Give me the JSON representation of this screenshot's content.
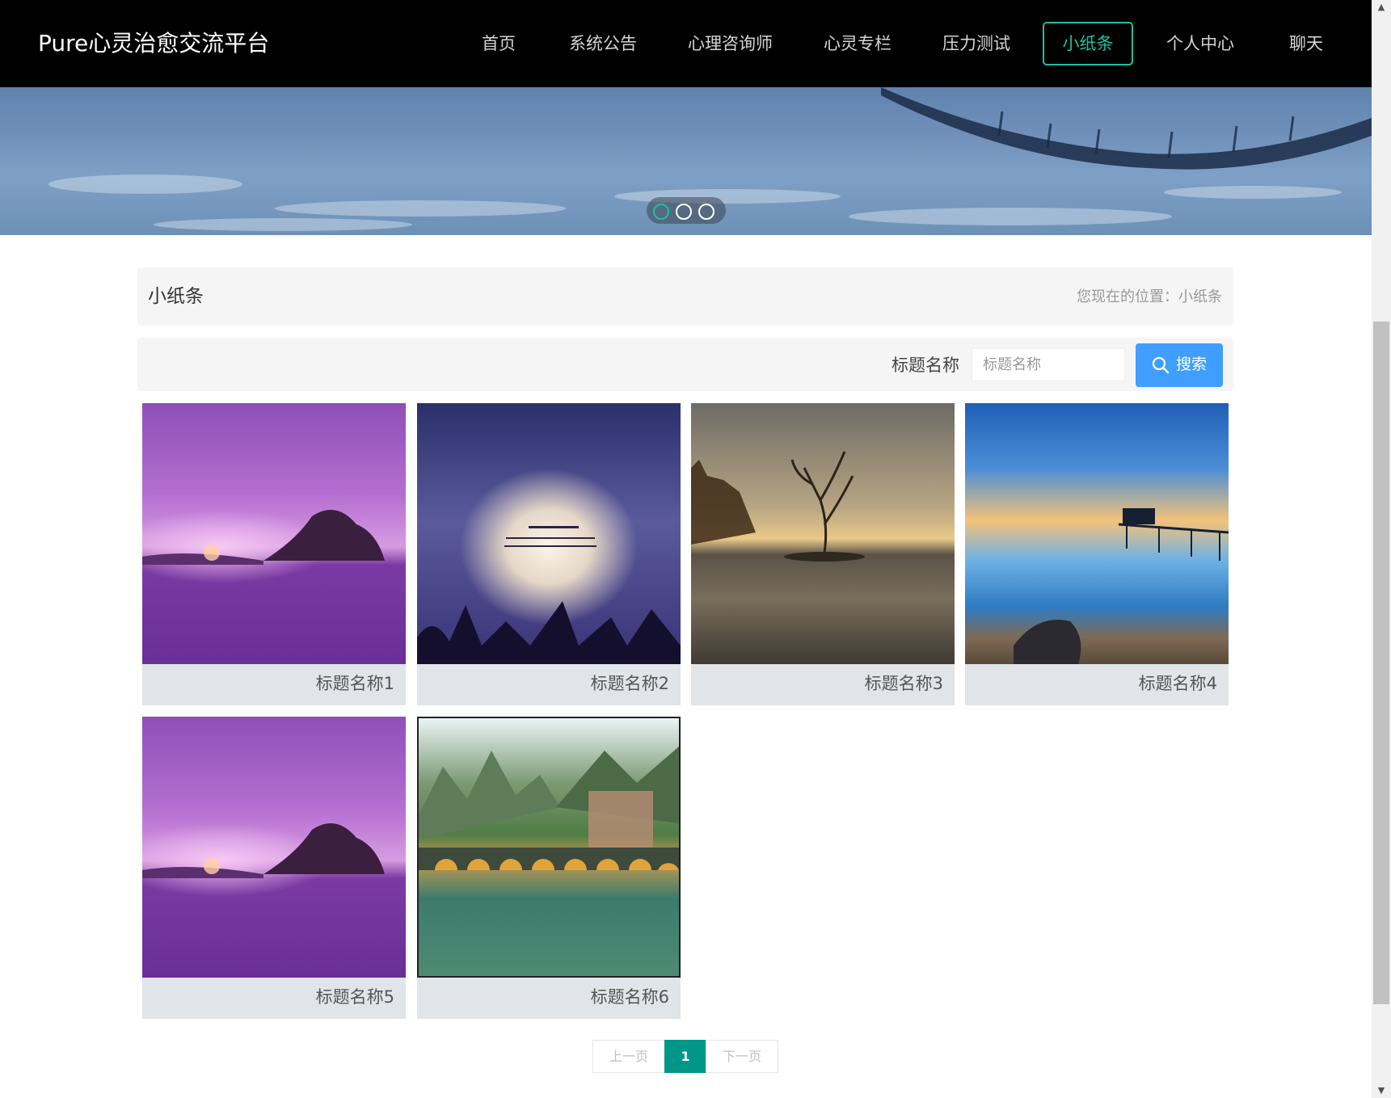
{
  "header": {
    "logo": "Pure心灵治愈交流平台",
    "nav": [
      "首页",
      "系统公告",
      "心理咨询师",
      "心灵专栏",
      "压力测试",
      "小纸条",
      "个人中心",
      "聊天"
    ],
    "active_nav": "小纸条"
  },
  "page": {
    "title": "小纸条",
    "location": "您现在的位置：小纸条"
  },
  "search": {
    "label": "标题名称",
    "placeholder": "标题名称",
    "button": "搜索"
  },
  "cards": [
    {
      "caption": "标题名称1",
      "image": "purple-sunset-sea"
    },
    {
      "caption": "标题名称2",
      "image": "clouds-poem-silhouette"
    },
    {
      "caption": "标题名称3",
      "image": "lone-tree-lake"
    },
    {
      "caption": "标题名称4",
      "image": "pier-sunset-beach"
    },
    {
      "caption": "标题名称5",
      "image": "purple-sunset-sea"
    },
    {
      "caption": "标题名称6",
      "image": "stone-bridge-village"
    }
  ],
  "pagination": {
    "prev": "上一页",
    "current": "1",
    "next": "下一页"
  },
  "colors": {
    "accent": "#1fbfa6",
    "search_button": "#409eff",
    "pager_active": "#009688"
  }
}
